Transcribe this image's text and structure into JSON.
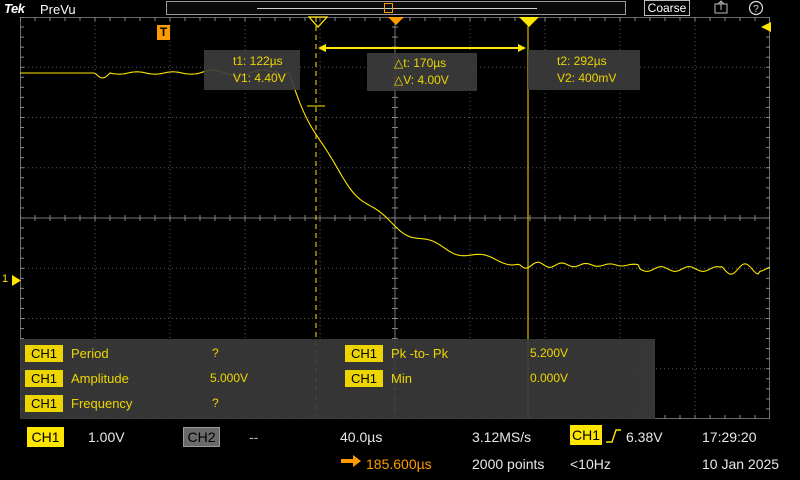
{
  "topbar": {
    "logo": "Tek",
    "status": "PreVu",
    "coarse_label": "Coarse"
  },
  "cursors": {
    "c1": {
      "time": "t1: 122µs",
      "volt": "V1: 4.40V"
    },
    "delta": {
      "time": "△t: 170µs",
      "volt": "△V: 4.00V"
    },
    "c2": {
      "time": "t2: 292µs",
      "volt": "V2: 400mV"
    }
  },
  "trigger_marker": "T",
  "ground_marker": "1",
  "measurements": {
    "left": [
      {
        "channel": "CH1",
        "name": "Period",
        "value": "?"
      },
      {
        "channel": "CH1",
        "name": "Amplitude",
        "value": "5.000V"
      },
      {
        "channel": "CH1",
        "name": "Frequency",
        "value": "?"
      }
    ],
    "right": [
      {
        "channel": "CH1",
        "name": "Pk -to- Pk",
        "value": "5.200V"
      },
      {
        "channel": "CH1",
        "name": "Min",
        "value": "0.000V"
      }
    ]
  },
  "status": {
    "ch1_label": "CH1",
    "ch1_scale": "1.00V",
    "ch2_label": "CH2",
    "ch2_scale": "--",
    "timebase": "40.0µs",
    "position": "185.600µs",
    "sample_rate": "3.12MS/s",
    "record_length": "2000 points",
    "trigger_source": "CH1",
    "trigger_level": "6.38V",
    "trigger_freq": "<10Hz",
    "time": "17:29:20",
    "date": "10 Jan 2025"
  },
  "colors": {
    "ch1": "#ffe600",
    "ch2": "#9a9a9a",
    "cursor": "#ffe600",
    "trigger": "#ff9a00"
  },
  "icons": [
    "record-view-icon",
    "save-icon",
    "help-icon",
    "trigger-position-icon",
    "trigger-level-arrow-icon",
    "ground-marker-icon",
    "rising-edge-icon",
    "position-arrow-icon"
  ]
}
